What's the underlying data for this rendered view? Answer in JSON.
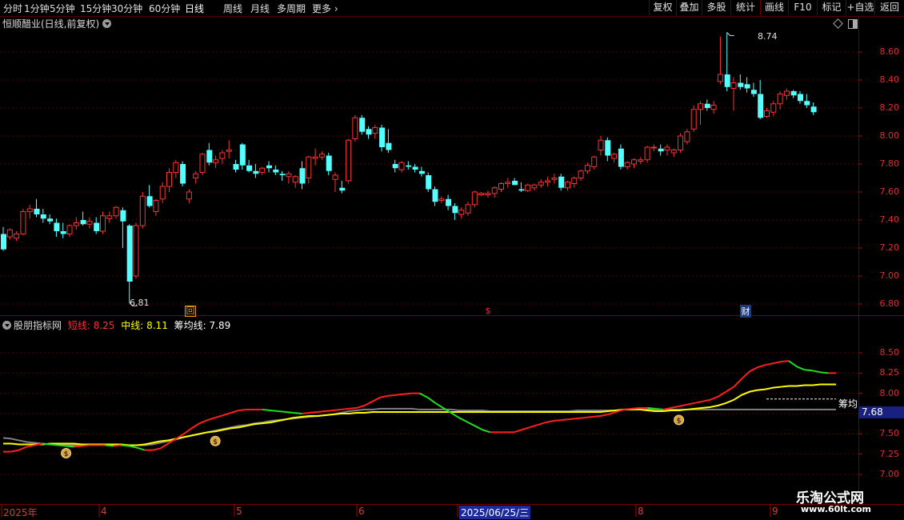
{
  "toolbar": {
    "periods": [
      "分时",
      "1分钟",
      "5分钟",
      "15分钟",
      "30分钟",
      "60分钟",
      "日线",
      "周线",
      "月线",
      "多周期",
      "更多"
    ],
    "active_period": "日线",
    "right_buttons": [
      "复权",
      "叠加",
      "多股",
      "统计",
      "画线",
      "F10",
      "标记",
      "+自选",
      "返回"
    ]
  },
  "main": {
    "title": "恒顺醋业(日线,前复权)",
    "high_label": "8.74",
    "low_label": "6.81",
    "event_marks": [
      "回",
      "$",
      "财"
    ],
    "yticks": [
      "8.60",
      "8.40",
      "8.20",
      "8.00",
      "7.80",
      "7.60",
      "7.40",
      "7.20",
      "7.00",
      "6.80"
    ]
  },
  "indicator": {
    "name": "股朋指标网",
    "short_label": "短线: 8.25",
    "mid_label": "中线: 8.11",
    "chip_label": "筹均线: 7.89",
    "chip_tag": "筹均",
    "price_tag": "7.68",
    "yticks": [
      "8.50",
      "8.25",
      "8.00",
      "7.75",
      "7.50",
      "7.25",
      "7.00"
    ]
  },
  "xaxis": {
    "labels": [
      "2025年",
      "4",
      "5",
      "6",
      "2025/06/25/三",
      "8",
      "9"
    ]
  },
  "watermark": {
    "line1": "乐淘公式网",
    "line2": "www.60lt.com"
  },
  "colors": {
    "up": "#ff3232",
    "down": "#54ffff",
    "short_up": "#ff2020",
    "short_down": "#22dd22",
    "mid": "#ffff00",
    "chip": "#808080",
    "grid": "#5a0000"
  },
  "chart_data": {
    "type": "candlestick",
    "title": "恒顺醋业(日线,前复权)",
    "ylim": [
      6.75,
      8.78
    ],
    "ohlc": [
      [
        7.3,
        7.35,
        7.18,
        7.19
      ],
      [
        7.28,
        7.34,
        7.26,
        7.33
      ],
      [
        7.27,
        7.32,
        7.25,
        7.3
      ],
      [
        7.3,
        7.48,
        7.29,
        7.46
      ],
      [
        7.46,
        7.51,
        7.41,
        7.48
      ],
      [
        7.48,
        7.55,
        7.42,
        7.44
      ],
      [
        7.44,
        7.48,
        7.38,
        7.41
      ],
      [
        7.41,
        7.44,
        7.37,
        7.39
      ],
      [
        7.38,
        7.41,
        7.28,
        7.32
      ],
      [
        7.32,
        7.38,
        7.27,
        7.3
      ],
      [
        7.3,
        7.37,
        7.28,
        7.36
      ],
      [
        7.36,
        7.42,
        7.33,
        7.38
      ],
      [
        7.4,
        7.46,
        7.36,
        7.37
      ],
      [
        7.37,
        7.42,
        7.34,
        7.39
      ],
      [
        7.38,
        7.42,
        7.3,
        7.32
      ],
      [
        7.32,
        7.46,
        7.3,
        7.43
      ],
      [
        7.41,
        7.46,
        7.38,
        7.43
      ],
      [
        7.43,
        7.5,
        7.41,
        7.49
      ],
      [
        7.47,
        7.49,
        7.2,
        7.39
      ],
      [
        7.36,
        7.37,
        6.81,
        6.96
      ],
      [
        7.0,
        7.38,
        6.98,
        7.36
      ],
      [
        7.36,
        7.6,
        7.34,
        7.57
      ],
      [
        7.57,
        7.65,
        7.49,
        7.5
      ],
      [
        7.46,
        7.55,
        7.43,
        7.54
      ],
      [
        7.55,
        7.67,
        7.52,
        7.64
      ],
      [
        7.64,
        7.77,
        7.6,
        7.74
      ],
      [
        7.74,
        7.83,
        7.7,
        7.81
      ],
      [
        7.8,
        7.82,
        7.64,
        7.66
      ],
      [
        7.55,
        7.62,
        7.52,
        7.6
      ],
      [
        7.7,
        7.75,
        7.66,
        7.73
      ],
      [
        7.74,
        7.88,
        7.72,
        7.87
      ],
      [
        7.9,
        7.95,
        7.79,
        7.81
      ],
      [
        7.81,
        7.86,
        7.77,
        7.83
      ],
      [
        7.84,
        7.9,
        7.8,
        7.88
      ],
      [
        7.89,
        7.97,
        7.84,
        7.9
      ],
      [
        7.8,
        7.83,
        7.74,
        7.76
      ],
      [
        7.94,
        7.95,
        7.76,
        7.79
      ],
      [
        7.79,
        7.83,
        7.74,
        7.75
      ],
      [
        7.75,
        7.8,
        7.7,
        7.73
      ],
      [
        7.74,
        7.78,
        7.72,
        7.77
      ],
      [
        7.79,
        7.82,
        7.74,
        7.77
      ],
      [
        7.76,
        7.79,
        7.72,
        7.74
      ],
      [
        7.73,
        7.75,
        7.68,
        7.72
      ],
      [
        7.71,
        7.75,
        7.66,
        7.73
      ],
      [
        7.67,
        7.72,
        7.63,
        7.71
      ],
      [
        7.77,
        7.82,
        7.62,
        7.66
      ],
      [
        7.7,
        7.86,
        7.66,
        7.85
      ],
      [
        7.84,
        7.91,
        7.79,
        7.85
      ],
      [
        7.85,
        7.89,
        7.83,
        7.87
      ],
      [
        7.86,
        7.88,
        7.72,
        7.75
      ],
      [
        7.69,
        7.74,
        7.6,
        7.72
      ],
      [
        7.63,
        7.68,
        7.59,
        7.61
      ],
      [
        7.68,
        7.98,
        7.66,
        7.97
      ],
      [
        7.98,
        8.15,
        7.96,
        8.13
      ],
      [
        8.13,
        8.15,
        8.01,
        8.03
      ],
      [
        8.05,
        8.07,
        7.98,
        8.01
      ],
      [
        8.02,
        8.08,
        7.98,
        8.06
      ],
      [
        8.06,
        8.08,
        7.89,
        7.92
      ],
      [
        7.95,
        8.05,
        7.88,
        7.9
      ],
      [
        7.8,
        7.83,
        7.74,
        7.77
      ],
      [
        7.76,
        7.82,
        7.74,
        7.81
      ],
      [
        7.79,
        7.82,
        7.76,
        7.78
      ],
      [
        7.78,
        7.8,
        7.74,
        7.76
      ],
      [
        7.75,
        7.78,
        7.71,
        7.73
      ],
      [
        7.72,
        7.74,
        7.6,
        7.62
      ],
      [
        7.62,
        7.64,
        7.5,
        7.53
      ],
      [
        7.54,
        7.57,
        7.52,
        7.55
      ],
      [
        7.55,
        7.58,
        7.47,
        7.5
      ],
      [
        7.5,
        7.52,
        7.4,
        7.45
      ],
      [
        7.44,
        7.49,
        7.41,
        7.47
      ],
      [
        7.45,
        7.53,
        7.43,
        7.51
      ],
      [
        7.51,
        7.61,
        7.49,
        7.6
      ],
      [
        7.58,
        7.6,
        7.57,
        7.59
      ],
      [
        7.58,
        7.61,
        7.56,
        7.59
      ],
      [
        7.59,
        7.64,
        7.56,
        7.63
      ],
      [
        7.62,
        7.67,
        7.6,
        7.66
      ],
      [
        7.66,
        7.7,
        7.63,
        7.67
      ],
      [
        7.68,
        7.7,
        7.65,
        7.65
      ],
      [
        7.62,
        7.67,
        7.6,
        7.61
      ],
      [
        7.61,
        7.66,
        7.6,
        7.65
      ],
      [
        7.63,
        7.66,
        7.61,
        7.65
      ],
      [
        7.65,
        7.69,
        7.63,
        7.67
      ],
      [
        7.67,
        7.71,
        7.64,
        7.68
      ],
      [
        7.69,
        7.73,
        7.66,
        7.7
      ],
      [
        7.71,
        7.73,
        7.61,
        7.63
      ],
      [
        7.63,
        7.68,
        7.61,
        7.67
      ],
      [
        7.66,
        7.71,
        7.63,
        7.7
      ],
      [
        7.7,
        7.76,
        7.68,
        7.75
      ],
      [
        7.75,
        7.81,
        7.73,
        7.79
      ],
      [
        7.78,
        7.86,
        7.76,
        7.85
      ],
      [
        7.9,
        8.0,
        7.86,
        7.97
      ],
      [
        7.97,
        7.99,
        7.82,
        7.86
      ],
      [
        7.84,
        7.88,
        7.81,
        7.87
      ],
      [
        7.91,
        7.94,
        7.76,
        7.78
      ],
      [
        7.78,
        7.82,
        7.76,
        7.81
      ],
      [
        7.8,
        7.84,
        7.77,
        7.83
      ],
      [
        7.82,
        7.85,
        7.8,
        7.83
      ],
      [
        7.83,
        7.93,
        7.81,
        7.92
      ],
      [
        7.92,
        7.94,
        7.89,
        7.92
      ],
      [
        7.91,
        7.94,
        7.86,
        7.89
      ],
      [
        7.9,
        7.94,
        7.86,
        7.92
      ],
      [
        7.88,
        7.91,
        7.85,
        7.9
      ],
      [
        7.9,
        8.02,
        7.88,
        8.0
      ],
      [
        7.96,
        8.05,
        7.94,
        8.03
      ],
      [
        8.05,
        8.22,
        8.03,
        8.19
      ],
      [
        8.19,
        8.25,
        8.08,
        8.23
      ],
      [
        8.23,
        8.26,
        8.18,
        8.2
      ],
      [
        8.19,
        8.25,
        8.16,
        8.22
      ],
      [
        8.39,
        8.71,
        8.37,
        8.44
      ],
      [
        8.44,
        8.74,
        8.32,
        8.35
      ],
      [
        8.34,
        8.42,
        8.18,
        8.38
      ],
      [
        8.38,
        8.44,
        8.33,
        8.35
      ],
      [
        8.37,
        8.42,
        8.31,
        8.34
      ],
      [
        8.33,
        8.38,
        8.28,
        8.3
      ],
      [
        8.3,
        8.4,
        8.12,
        8.13
      ],
      [
        8.14,
        8.2,
        8.13,
        8.18
      ],
      [
        8.17,
        8.25,
        8.14,
        8.23
      ],
      [
        8.23,
        8.32,
        8.19,
        8.3
      ],
      [
        8.29,
        8.34,
        8.26,
        8.32
      ],
      [
        8.32,
        8.33,
        8.27,
        8.29
      ],
      [
        8.3,
        8.32,
        8.23,
        8.25
      ],
      [
        8.25,
        8.3,
        8.2,
        8.22
      ],
      [
        8.21,
        8.24,
        8.15,
        8.17
      ]
    ],
    "indicator": {
      "series": [
        {
          "name": "短线",
          "values": [
            7.28,
            7.28,
            7.3,
            7.34,
            7.36,
            7.38,
            7.37,
            7.36,
            7.35,
            7.34,
            7.35,
            7.36,
            7.36,
            7.36,
            7.35,
            7.36,
            7.35,
            7.33,
            7.3,
            7.3,
            7.32,
            7.38,
            7.44,
            7.5,
            7.57,
            7.63,
            7.67,
            7.7,
            7.73,
            7.76,
            7.79,
            7.8,
            7.8,
            7.8,
            7.79,
            7.78,
            7.77,
            7.76,
            7.75,
            7.76,
            7.77,
            7.78,
            7.79,
            7.8,
            7.81,
            7.82,
            7.85,
            7.9,
            7.95,
            7.97,
            7.98,
            7.99,
            8.0,
            8.0,
            7.95,
            7.88,
            7.82,
            7.76,
            7.7,
            7.65,
            7.6,
            7.55,
            7.52,
            7.52,
            7.52,
            7.52,
            7.55,
            7.58,
            7.61,
            7.64,
            7.66,
            7.67,
            7.68,
            7.69,
            7.7,
            7.71,
            7.72,
            7.74,
            7.77,
            7.8,
            7.81,
            7.82,
            7.82,
            7.81,
            7.8,
            7.82,
            7.84,
            7.86,
            7.88,
            7.9,
            7.92,
            7.96,
            8.02,
            8.08,
            8.18,
            8.27,
            8.32,
            8.35,
            8.37,
            8.39,
            8.4,
            8.33,
            8.29,
            8.28,
            8.26,
            8.25,
            8.25
          ]
        },
        {
          "name": "中线",
          "values": [
            7.38,
            7.38,
            7.37,
            7.37,
            7.37,
            7.37,
            7.38,
            7.38,
            7.38,
            7.38,
            7.37,
            7.37,
            7.37,
            7.37,
            7.37,
            7.37,
            7.36,
            7.36,
            7.37,
            7.39,
            7.41,
            7.42,
            7.44,
            7.46,
            7.48,
            7.5,
            7.52,
            7.53,
            7.55,
            7.57,
            7.58,
            7.6,
            7.62,
            7.63,
            7.64,
            7.66,
            7.68,
            7.7,
            7.71,
            7.72,
            7.72,
            7.73,
            7.74,
            7.75,
            7.75,
            7.76,
            7.76,
            7.77,
            7.77,
            7.77,
            7.77,
            7.77,
            7.77,
            7.77,
            7.77,
            7.77,
            7.77,
            7.77,
            7.77,
            7.77,
            7.77,
            7.77,
            7.77,
            7.77,
            7.77,
            7.77,
            7.77,
            7.77,
            7.77,
            7.77,
            7.77,
            7.77,
            7.77,
            7.77,
            7.77,
            7.77,
            7.77,
            7.78,
            7.79,
            7.8,
            7.8,
            7.8,
            7.79,
            7.78,
            7.78,
            7.79,
            7.79,
            7.8,
            7.81,
            7.82,
            7.83,
            7.85,
            7.88,
            7.92,
            7.98,
            8.02,
            8.04,
            8.05,
            8.07,
            8.08,
            8.09,
            8.09,
            8.1,
            8.1,
            8.11,
            8.11,
            8.11
          ]
        },
        {
          "name": "筹均线",
          "values": [
            7.45,
            7.44,
            7.42,
            7.4,
            7.39,
            7.38,
            7.37,
            7.37,
            7.36,
            7.36,
            7.36,
            7.36,
            7.36,
            7.36,
            7.36,
            7.36,
            7.36,
            7.36,
            7.36,
            7.37,
            7.39,
            7.41,
            7.43,
            7.46,
            7.48,
            7.5,
            7.52,
            7.54,
            7.56,
            7.58,
            7.6,
            7.61,
            7.63,
            7.64,
            7.66,
            7.67,
            7.68,
            7.69,
            7.7,
            7.71,
            7.72,
            7.73,
            7.74,
            7.76,
            7.78,
            7.79,
            7.8,
            7.8,
            7.81,
            7.81,
            7.81,
            7.81,
            7.81,
            7.8,
            7.8,
            7.8,
            7.8,
            7.8,
            7.79,
            7.79,
            7.79,
            7.79,
            7.78,
            7.78,
            7.78,
            7.78,
            7.78,
            7.78,
            7.78,
            7.78,
            7.78,
            7.78,
            7.78,
            7.79,
            7.79,
            7.79,
            7.79,
            7.79,
            7.79,
            7.8,
            7.8,
            7.8,
            7.8,
            7.8,
            7.8,
            7.8,
            7.8,
            7.8,
            7.8,
            7.8,
            7.8,
            7.8,
            7.8,
            7.8,
            7.8,
            7.8,
            7.8,
            7.8,
            7.8,
            7.8,
            7.8,
            7.8,
            7.8,
            7.8,
            7.8,
            7.8,
            7.8
          ]
        }
      ],
      "ylim": [
        7.0,
        8.62
      ],
      "buy_signals": [
        8,
        27,
        86
      ]
    }
  }
}
